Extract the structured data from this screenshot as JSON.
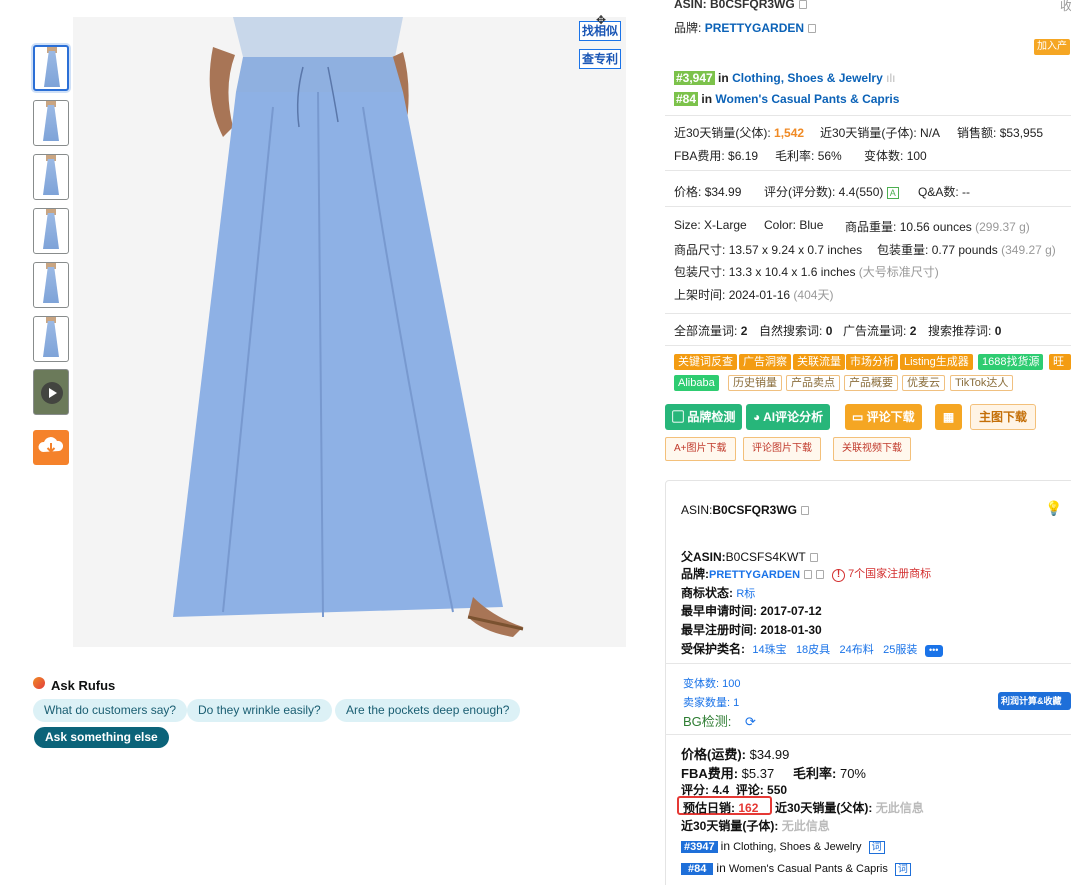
{
  "gallery": {
    "thumbnails": [
      "thumb-1",
      "thumb-2",
      "thumb-3",
      "thumb-4",
      "thumb-5",
      "thumb-6"
    ],
    "video_thumb": "play-icon",
    "download_icon": "cloud-download-icon"
  },
  "image_tools": {
    "find_similar": "找相似",
    "check_patent": "查专利"
  },
  "rufus": {
    "title": "Ask Rufus",
    "chips": [
      "What do customers say?",
      "Do they wrinkle easily?",
      "Are the pockets deep enough?"
    ],
    "ask_else": "Ask something else"
  },
  "info": {
    "asin_label": "ASIN:",
    "asin": "B0CSFQR3WG",
    "collect": "收",
    "brand_label": "品牌:",
    "brand": "PRETTYGARDEN",
    "add_to": "加入产",
    "rank1": "#3,947",
    "in": "in",
    "cat1": "Clothing, Shoes & Jewelry",
    "rank2": "#84",
    "cat2": "Women's Casual Pants & Capris",
    "sales30_parent_label": "近30天销量(父体):",
    "sales30_parent": "1,542",
    "sales30_child_label": "近30天销量(子体):",
    "sales30_child": "N/A",
    "revenue_label": "销售额:",
    "revenue": "$53,955",
    "fba_label": "FBA费用:",
    "fba": "$6.19",
    "margin_label": "毛利率:",
    "margin": "56%",
    "variants_label": "变体数:",
    "variants": "100",
    "price_label": "价格:",
    "price": "$34.99",
    "rating_label": "评分(评分数):",
    "rating": "4.4(550)",
    "rating_badge": "A",
    "qa_label": "Q&A数:",
    "qa": "--",
    "size_label": "Size:",
    "size": "X-Large",
    "color_label": "Color:",
    "color": "Blue",
    "weight_label": "商品重量:",
    "weight": "10.56 ounces",
    "weight_g": "(299.37 g)",
    "dims_label": "商品尺寸:",
    "dims": "13.57 x 9.24 x 0.7 inches",
    "pkg_weight_label": "包装重量:",
    "pkg_weight": "0.77 pounds",
    "pkg_weight_g": "(349.27 g)",
    "pkg_dims_label": "包装尺寸:",
    "pkg_dims": "13.3 x 10.4 x 1.6 inches",
    "pkg_type": "(大号标准尺寸)",
    "listed_label": "上架时间:",
    "listed": "2024-01-16",
    "listed_days": "(404天)",
    "all_kw_label": "全部流量词:",
    "all_kw": "2",
    "organic_kw_label": "自然搜索词:",
    "organic_kw": "0",
    "ad_kw_label": "广告流量词:",
    "ad_kw": "2",
    "rec_kw_label": "搜索推荐词:",
    "rec_kw": "0"
  },
  "tags_row1": [
    "关键词反查",
    "广告洞察",
    "关联流量",
    "市场分析",
    "Listing生成器",
    "1688找货源",
    "旺店"
  ],
  "tags_row2": [
    "Alibaba",
    "历史销量",
    "产品卖点",
    "产品概要",
    "优麦云",
    "TikTok达人"
  ],
  "actions": {
    "brand_check": "品牌检测",
    "ai_review": "AI评论分析",
    "review_dl": "评论下载",
    "main_img_dl": "主图下载",
    "aplus_dl": "A+图片下载",
    "review_img_dl": "评论图片下载",
    "video_dl": "关联视频下载"
  },
  "panel": {
    "asin_label": "ASIN:",
    "asin": "B0CSFQR3WG",
    "parent_label": "父ASIN:",
    "parent": "B0CSFS4KWT",
    "brand_label": "品牌:",
    "brand": "PRETTYGARDEN",
    "trademark_warn": "7个国家注册商标",
    "tm_status_label": "商标状态:",
    "tm_status": "R标",
    "earliest_apply_label": "最早申请时间:",
    "earliest_apply": "2017-07-12",
    "earliest_reg_label": "最早注册时间:",
    "earliest_reg": "2018-01-30",
    "protected_label": "受保护类名:",
    "protected": [
      "14珠宝",
      "18皮具",
      "24布料",
      "25服装"
    ],
    "variants": "变体数: 100",
    "sellers": "卖家数量: 1",
    "profit_btn": "利润计算&收藏商",
    "bg_label": "BG检测:",
    "price_label": "价格(运费):",
    "price": "$34.99",
    "fba_label": "FBA费用:",
    "fba": "$5.37",
    "margin_label": "毛利率:",
    "margin": "70%",
    "rating_label": "评分:",
    "rating": "4.4",
    "reviews_label": "评论:",
    "reviews": "550",
    "daily_label": "预估日销:",
    "daily": "162",
    "sales30p_label": "近30天销量(父体):",
    "no_info": "无此信息",
    "sales30c_label": "近30天销量(子体):",
    "rank1": "#3947",
    "cat1": "Clothing, Shoes & Jewelry",
    "rank2": "#84",
    "cat2": "Women's Casual Pants & Capris",
    "in": "in",
    "ci": "词"
  }
}
